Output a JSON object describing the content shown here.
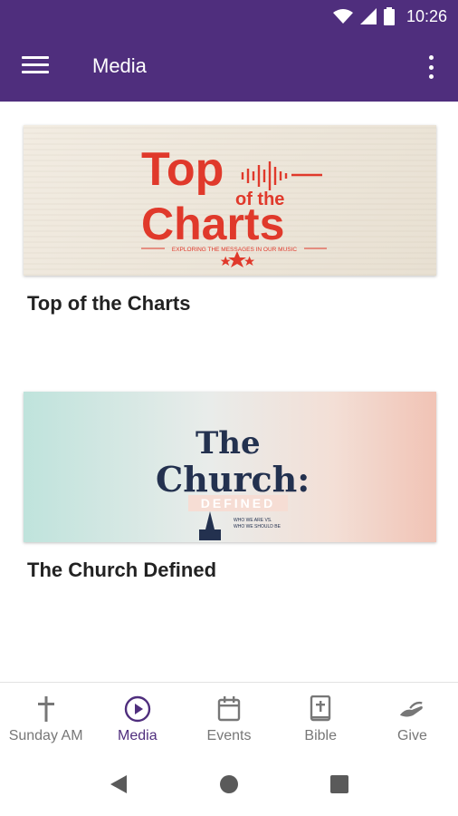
{
  "status_bar": {
    "time": "10:26"
  },
  "app_bar": {
    "title": "Media"
  },
  "media_items": [
    {
      "title": "Top of the Charts",
      "banner": {
        "line1": "Top",
        "line2": "of the",
        "line3": "Charts",
        "tagline": "EXPLORING THE MESSAGES IN OUR MUSIC"
      }
    },
    {
      "title": "The Church Defined",
      "banner": {
        "line1": "The",
        "line2": "Church:",
        "line3": "DEFINED",
        "tagline1": "WHO WE ARE VS.",
        "tagline2": "WHO WE SHOULD BE"
      }
    }
  ],
  "bottom_nav": [
    {
      "label": "Sunday AM",
      "icon": "cross-icon",
      "active": false
    },
    {
      "label": "Media",
      "icon": "play-circle-icon",
      "active": true
    },
    {
      "label": "Events",
      "icon": "calendar-icon",
      "active": false
    },
    {
      "label": "Bible",
      "icon": "bible-icon",
      "active": false
    },
    {
      "label": "Give",
      "icon": "giving-hand-icon",
      "active": false
    }
  ],
  "colors": {
    "primary": "#4f2e7d",
    "charts_red": "#e0392b",
    "church_navy": "#23314f"
  }
}
